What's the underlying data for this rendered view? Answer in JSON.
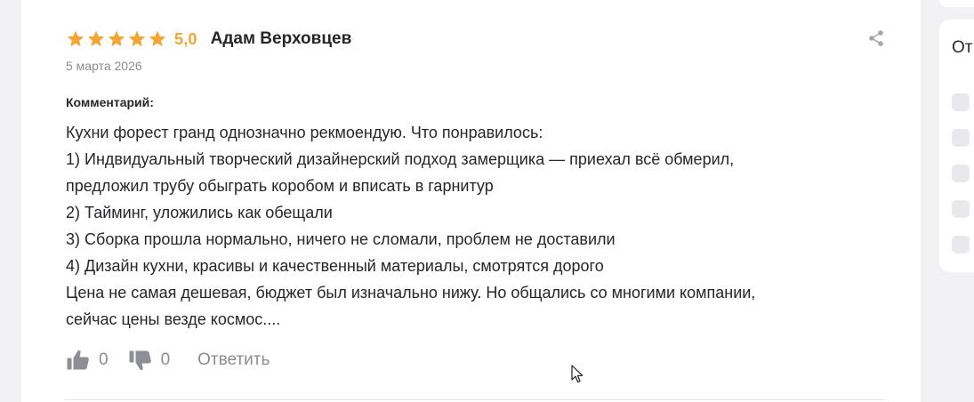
{
  "review": {
    "rating": 5,
    "rating_label": "5,0",
    "author": "Адам Верховцев",
    "date": "5 марта 2026",
    "comment_label": "Комментарий:",
    "comment_lines": [
      "Кухни форест гранд однозначно рекмоендую. Что понравилось:",
      "1) Индвидуальный творческий дизайнерский подход замерщика — приехал всё обмерил,",
      "предложил трубу обыграть коробом и вписать в гарнитур",
      "2) Тайминг, уложились как обещали",
      "3) Сборка прошла нормально, ничего не сломали, проблем не доставили",
      "4) Дизайн кухни, красивы и качественный материалы, смотрятся дорого",
      "Цена не самая дешевая, бюджет был изначально нижу. Но общались со многими компании,",
      "сейчас цены везде космос...."
    ],
    "likes": "0",
    "dislikes": "0",
    "reply_label": "Ответить"
  },
  "sidebar": {
    "title_partial": "От",
    "checkbox_count": 5
  },
  "icons": {
    "star": "star-icon",
    "share": "share-icon",
    "like": "thumbs-up-icon",
    "dislike": "thumbs-down-icon"
  },
  "colors": {
    "star": "#f4a533",
    "text": "#26262b",
    "muted": "#8b8b93",
    "vote_icon": "#8e8e96",
    "background": "#f2f2f4",
    "card": "#ffffff"
  }
}
